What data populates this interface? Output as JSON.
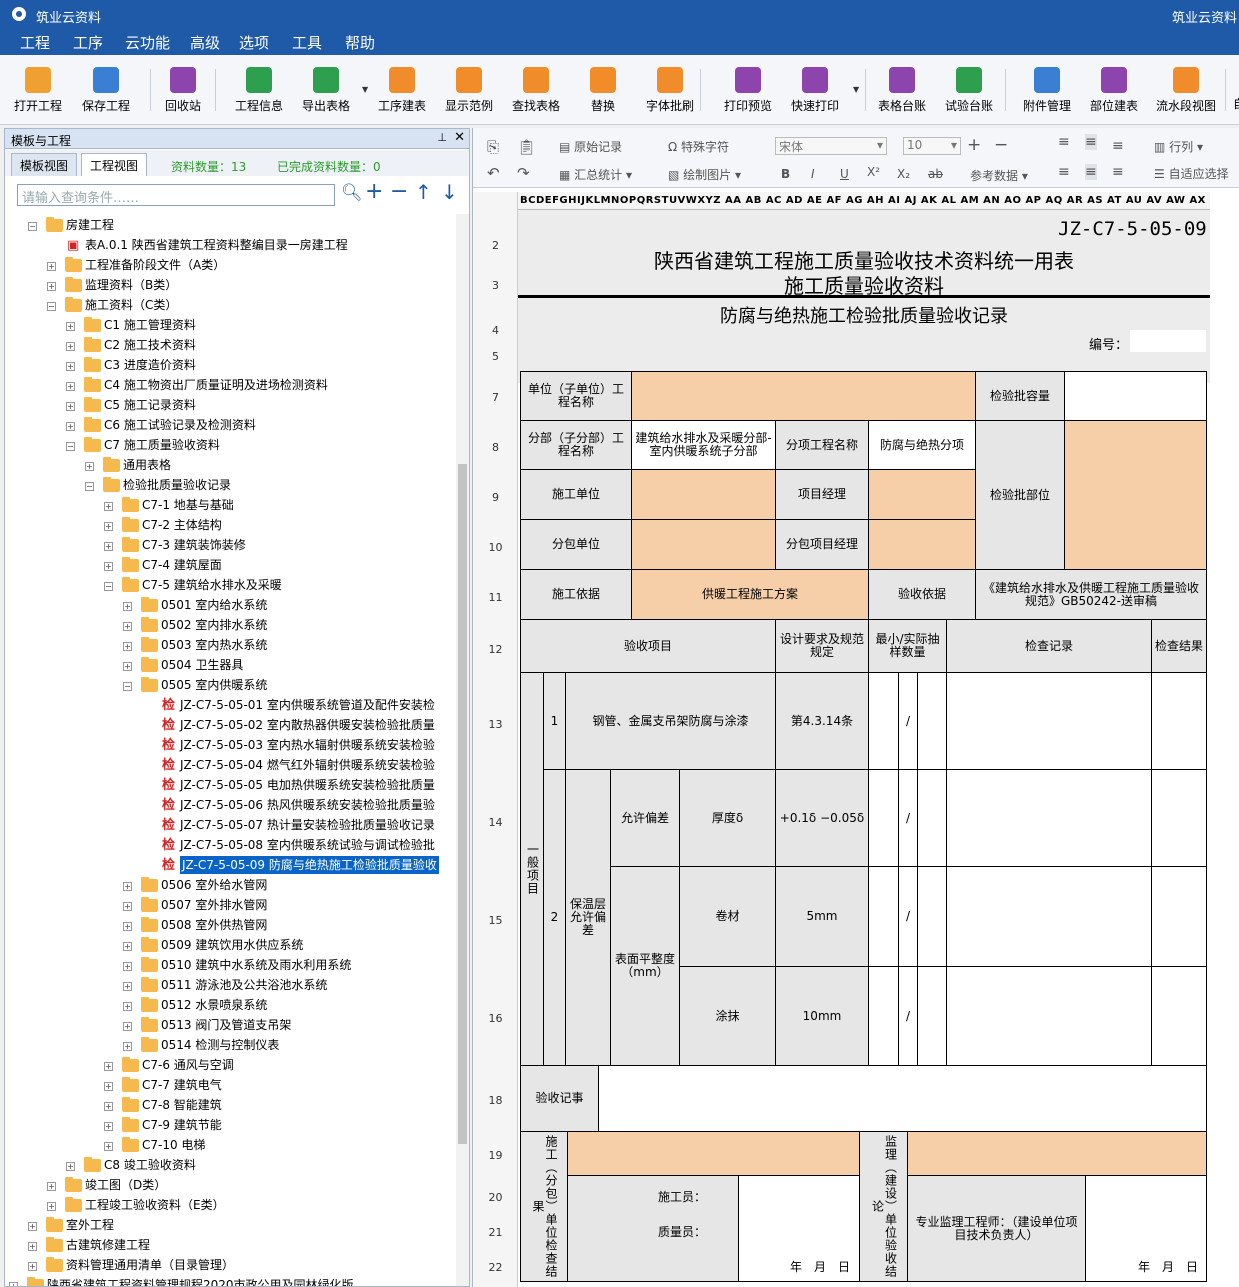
{
  "app": {
    "title": "筑业云资料",
    "title_right": "筑业云资料"
  },
  "menu": [
    "工程",
    "工序",
    "云功能",
    "高级",
    "选项",
    "工具",
    "帮助"
  ],
  "toolbar": {
    "items": [
      {
        "label": "打开工程",
        "icon": "folder-open-icon",
        "color": "#f0a030"
      },
      {
        "label": "保存工程",
        "icon": "save-icon",
        "color": "#3b7fd4"
      },
      {
        "label": "回收站",
        "icon": "trash-icon",
        "color": "#8e44ad"
      },
      {
        "label": "工程信息",
        "icon": "info-icon",
        "color": "#2e9e4f"
      },
      {
        "label": "导出表格",
        "icon": "export-icon",
        "color": "#2e9e4f"
      },
      {
        "label": "工序建表",
        "icon": "layers-icon",
        "color": "#f08c2a"
      },
      {
        "label": "显示范例",
        "icon": "example-icon",
        "color": "#f08c2a"
      },
      {
        "label": "查找表格",
        "icon": "search-table-icon",
        "color": "#f08c2a"
      },
      {
        "label": "替换",
        "icon": "replace-icon",
        "color": "#f08c2a"
      },
      {
        "label": "字体批刷",
        "icon": "font-brush-icon",
        "color": "#f08c2a"
      },
      {
        "label": "打印预览",
        "icon": "eye-icon",
        "color": "#8e44ad"
      },
      {
        "label": "快速打印",
        "icon": "printer-icon",
        "color": "#8e44ad"
      },
      {
        "label": "表格台账",
        "icon": "ledger-icon",
        "color": "#8e44ad"
      },
      {
        "label": "试验台账",
        "icon": "test-ledger-icon",
        "color": "#2e9e4f"
      },
      {
        "label": "附件管理",
        "icon": "paperclip-icon",
        "color": "#3b7fd4"
      },
      {
        "label": "部位建表",
        "icon": "grid-icon",
        "color": "#8e44ad"
      },
      {
        "label": "流水段视图",
        "icon": "flow-icon",
        "color": "#f08c2a"
      }
    ],
    "overflow_label": "自"
  },
  "left_panel": {
    "title": "模板与工程",
    "tabs": [
      "模板视图",
      "工程视图"
    ],
    "count_label": "资料数量：13",
    "done_label": "已完成资料数量：0",
    "search_placeholder": "请输入查询条件……",
    "tree": [
      {
        "label": "房建工程",
        "depth": 2,
        "type": "folder",
        "open": true
      },
      {
        "label": "表A.0.1 陕西省建筑工程资料整编目录一房建工程",
        "depth": 3,
        "type": "doc"
      },
      {
        "label": "工程准备阶段文件（A类）",
        "depth": 3,
        "type": "folder"
      },
      {
        "label": "监理资料（B类）",
        "depth": 3,
        "type": "folder"
      },
      {
        "label": "施工资料（C类）",
        "depth": 3,
        "type": "folder",
        "open": true
      },
      {
        "label": "C1 施工管理资料",
        "depth": 4,
        "type": "folder"
      },
      {
        "label": "C2 施工技术资料",
        "depth": 4,
        "type": "folder"
      },
      {
        "label": "C3 进度造价资料",
        "depth": 4,
        "type": "folder"
      },
      {
        "label": "C4 施工物资出厂质量证明及进场检测资料",
        "depth": 4,
        "type": "folder"
      },
      {
        "label": "C5 施工记录资料",
        "depth": 4,
        "type": "folder"
      },
      {
        "label": "C6 施工试验记录及检测资料",
        "depth": 4,
        "type": "folder"
      },
      {
        "label": "C7 施工质量验收资料",
        "depth": 4,
        "type": "folder",
        "open": true
      },
      {
        "label": "通用表格",
        "depth": 5,
        "type": "folder"
      },
      {
        "label": "检验批质量验收记录",
        "depth": 5,
        "type": "folder",
        "open": true
      },
      {
        "label": "C7-1 地基与基础",
        "depth": 6,
        "type": "folder"
      },
      {
        "label": "C7-2 主体结构",
        "depth": 6,
        "type": "folder"
      },
      {
        "label": "C7-3 建筑装饰装修",
        "depth": 6,
        "type": "folder"
      },
      {
        "label": "C7-4 建筑屋面",
        "depth": 6,
        "type": "folder"
      },
      {
        "label": "C7-5 建筑给水排水及采暖",
        "depth": 6,
        "type": "folder",
        "open": true
      },
      {
        "label": "0501 室内给水系统",
        "depth": 7,
        "type": "folder"
      },
      {
        "label": "0502 室内排水系统",
        "depth": 7,
        "type": "folder"
      },
      {
        "label": "0503 室内热水系统",
        "depth": 7,
        "type": "folder"
      },
      {
        "label": "0504 卫生器具",
        "depth": 7,
        "type": "folder"
      },
      {
        "label": "0505 室内供暖系统",
        "depth": 7,
        "type": "folder",
        "open": true
      },
      {
        "label": "JZ-C7-5-05-01 室内供暖系统管道及配件安装检",
        "depth": 8,
        "type": "check"
      },
      {
        "label": "JZ-C7-5-05-02 室内散热器供暖安装检验批质量",
        "depth": 8,
        "type": "check"
      },
      {
        "label": "JZ-C7-5-05-03 室内热水辐射供暖系统安装检验",
        "depth": 8,
        "type": "check"
      },
      {
        "label": "JZ-C7-5-05-04 燃气红外辐射供暖系统安装检验",
        "depth": 8,
        "type": "check"
      },
      {
        "label": "JZ-C7-5-05-05 电加热供暖系统安装检验批质量",
        "depth": 8,
        "type": "check"
      },
      {
        "label": "JZ-C7-5-05-06 热风供暖系统安装检验批质量验",
        "depth": 8,
        "type": "check"
      },
      {
        "label": "JZ-C7-5-05-07 热计量安装检验批质量验收记录",
        "depth": 8,
        "type": "check"
      },
      {
        "label": "JZ-C7-5-05-08 室内供暖系统试验与调试检验批",
        "depth": 8,
        "type": "check"
      },
      {
        "label": "JZ-C7-5-05-09 防腐与绝热施工检验批质量验收",
        "depth": 8,
        "type": "check",
        "selected": true
      },
      {
        "label": "0506 室外给水管网",
        "depth": 7,
        "type": "folder"
      },
      {
        "label": "0507 室外排水管网",
        "depth": 7,
        "type": "folder"
      },
      {
        "label": "0508 室外供热管网",
        "depth": 7,
        "type": "folder"
      },
      {
        "label": "0509 建筑饮用水供应系统",
        "depth": 7,
        "type": "folder"
      },
      {
        "label": "0510 建筑中水系统及雨水利用系统",
        "depth": 7,
        "type": "folder"
      },
      {
        "label": "0511 游泳池及公共浴池水系统",
        "depth": 7,
        "type": "folder"
      },
      {
        "label": "0512 水景喷泉系统",
        "depth": 7,
        "type": "folder"
      },
      {
        "label": "0513 阀门及管道支吊架",
        "depth": 7,
        "type": "folder"
      },
      {
        "label": "0514 检测与控制仪表",
        "depth": 7,
        "type": "folder"
      },
      {
        "label": "C7-6 通风与空调",
        "depth": 6,
        "type": "folder"
      },
      {
        "label": "C7-7 建筑电气",
        "depth": 6,
        "type": "folder"
      },
      {
        "label": "C7-8 智能建筑",
        "depth": 6,
        "type": "folder"
      },
      {
        "label": "C7-9 建筑节能",
        "depth": 6,
        "type": "folder"
      },
      {
        "label": "C7-10 电梯",
        "depth": 6,
        "type": "folder"
      },
      {
        "label": "C8 竣工验收资料",
        "depth": 4,
        "type": "folder"
      },
      {
        "label": "竣工图（D类）",
        "depth": 3,
        "type": "folder"
      },
      {
        "label": "工程竣工验收资料（E类）",
        "depth": 3,
        "type": "folder"
      },
      {
        "label": "室外工程",
        "depth": 2,
        "type": "folder"
      },
      {
        "label": "古建筑修建工程",
        "depth": 2,
        "type": "folder"
      },
      {
        "label": "资料管理通用清单（目录管理）",
        "depth": 2,
        "type": "folder"
      },
      {
        "label": "陕西省建筑工程资料管理规程2020市政公用及园林绿化版",
        "depth": 1,
        "type": "folder"
      }
    ]
  },
  "doc_toolbar": {
    "original_record": "原始记录",
    "summary": "汇总统计",
    "special_char": "特殊字符",
    "draw_image": "绘制图片",
    "font_name": "宋体",
    "font_size": "10",
    "ref_data": "参考数据",
    "row_col": "行列",
    "auto_fit": "自适应选择"
  },
  "sheet": {
    "col_header": "BCDEFGHIJKLMNOPQRSTUVWXYZ AA AB AC AD AE AF AG AH AI AJ AK AL AM AN AO AP AQ AR AS AT AU AV AW AX AY AZ BA BB BC BD BE BF BG BH BI BJ",
    "row_numbers": [
      "2",
      "3",
      "4",
      "5",
      "7",
      "8",
      "9",
      "10",
      "11",
      "12",
      "13",
      "14",
      "15",
      "16",
      "18",
      "19",
      "20",
      "21",
      "22"
    ]
  },
  "form": {
    "code": "JZ-C7-5-05-09",
    "title1": "陕西省建筑工程施工质量验收技术资料统一用表",
    "title2": "施工质量验收资料",
    "subtitle": "防腐与绝热施工检验批质量验收记录",
    "number_label": "编号：",
    "unit_label": "单位（子单位）工程名称",
    "batch_capacity": "检验批容量",
    "division_label": "分部（子分部）工程名称",
    "division_value": "建筑给水排水及采暖分部-室内供暖系统子分部",
    "subitem_label": "分项工程名称",
    "subitem_value": "防腐与绝热分项",
    "batch_location": "检验批部位",
    "construction_unit": "施工单位",
    "project_manager": "项目经理",
    "subcontract_unit": "分包单位",
    "subcontract_manager": "分包项目经理",
    "construction_basis": "施工依据",
    "construction_basis_value": "供暖工程施工方案",
    "acceptance_basis": "验收依据",
    "acceptance_basis_value": "《建筑给水排水及供暖工程施工质量验收规范》GB50242-送审稿",
    "h_item": "验收项目",
    "h_design": "设计要求及规范规定",
    "h_sample": "最小/实际抽样数量",
    "h_record": "检查记录",
    "h_result": "检查结果",
    "general_items": "一般项目",
    "r1_no": "1",
    "r1_item": "钢管、金属支吊架防腐与涂漆",
    "r1_design": "第4.3.14条",
    "r1_sample": "/",
    "r2_no": "2",
    "r2_group": "保温层允许偏差",
    "r2_allow": "允许偏差",
    "r2_thick": "厚度δ",
    "r2_thick_design": "+0.1δ −0.05δ",
    "r2_thick_sample": "/",
    "r2_flat": "表面平整度（mm）",
    "r2_roll": "卷材",
    "r2_roll_design": "5mm",
    "r2_roll_sample": "/",
    "r2_paint": "涂抹",
    "r2_paint_design": "10mm",
    "r2_paint_sample": "/",
    "remarks": "验收记事",
    "constr_result": "施工（分包）单位检查结果",
    "constructor": "施工员：",
    "qc": "质量员：",
    "date1": "年　月　日",
    "supervisor_result": "监理（建设）单位验收结论",
    "supervisor_engineer": "专业监理工程师：（建设单位项目技术负责人）",
    "date2": "年　月　日"
  }
}
